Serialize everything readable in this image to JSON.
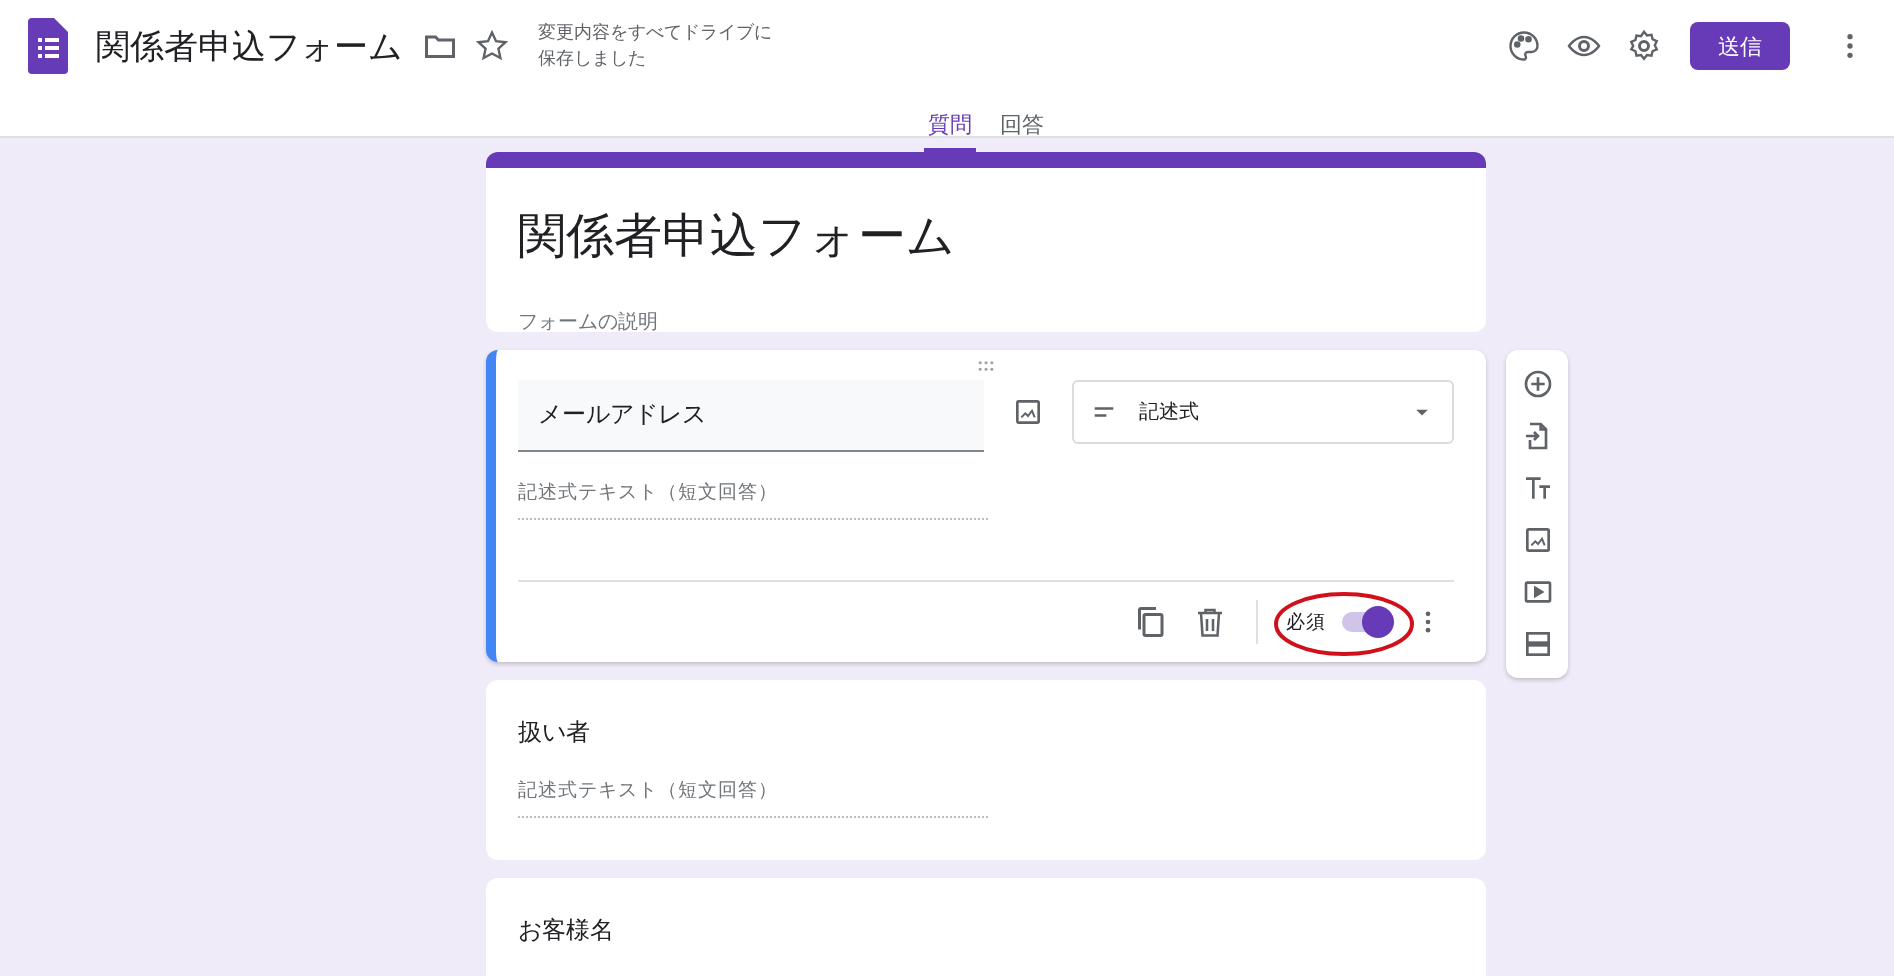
{
  "header": {
    "title": "関係者申込フォーム",
    "save_status": "変更内容をすべてドライブに保存しました",
    "send_button": "送信"
  },
  "tabs": [
    {
      "label": "質問",
      "selected": true
    },
    {
      "label": "回答",
      "selected": false
    }
  ],
  "form": {
    "title": "関係者申込フォーム",
    "description_placeholder": "フォームの説明"
  },
  "questions": [
    {
      "title": "メールアドレス",
      "active": true,
      "answer_placeholder": "記述式テキスト（短文回答）",
      "type": "記述式",
      "required_label": "必須",
      "required": true
    },
    {
      "title": "扱い者",
      "active": false,
      "answer_placeholder": "記述式テキスト（短文回答）"
    },
    {
      "title": "お客様名",
      "active": false
    }
  ]
}
